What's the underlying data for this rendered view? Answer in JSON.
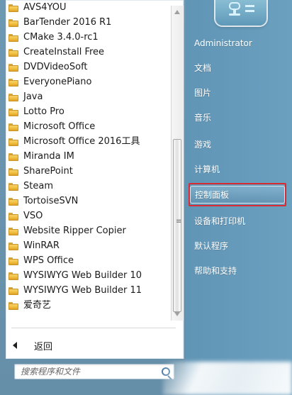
{
  "programs": [
    {
      "label": "AVS4YOU"
    },
    {
      "label": "BarTender 2016 R1"
    },
    {
      "label": "CMake 3.4.0-rc1"
    },
    {
      "label": "CreateInstall Free"
    },
    {
      "label": "DVDVideoSoft"
    },
    {
      "label": "EveryonePiano"
    },
    {
      "label": "Java"
    },
    {
      "label": "Lotto Pro"
    },
    {
      "label": "Microsoft Office"
    },
    {
      "label": "Microsoft Office 2016工具"
    },
    {
      "label": "Miranda IM"
    },
    {
      "label": "SharePoint"
    },
    {
      "label": "Steam"
    },
    {
      "label": "TortoiseSVN"
    },
    {
      "label": "VSO"
    },
    {
      "label": "Website Ripper Copier"
    },
    {
      "label": "WinRAR"
    },
    {
      "label": "WPS Office"
    },
    {
      "label": "WYSIWYG Web Builder 10"
    },
    {
      "label": "WYSIWYG Web Builder 11"
    },
    {
      "label": "爱奇艺"
    }
  ],
  "back": {
    "label": "返回"
  },
  "search": {
    "placeholder": "搜索程序和文件"
  },
  "right_items": [
    {
      "label": "Administrator"
    },
    {
      "label": "文档"
    },
    {
      "label": "图片"
    },
    {
      "label": "音乐"
    },
    {
      "label": "游戏"
    },
    {
      "label": "计算机"
    },
    {
      "label": "控制面板"
    },
    {
      "label": "设备和打印机"
    },
    {
      "label": "默认程序"
    },
    {
      "label": "帮助和支持"
    }
  ],
  "icons": {
    "folder": "folder-icon",
    "search": "search-icon",
    "computer": "computer-icon",
    "back": "back-arrow-icon"
  },
  "colors": {
    "highlight_outline": "#d62b33"
  }
}
